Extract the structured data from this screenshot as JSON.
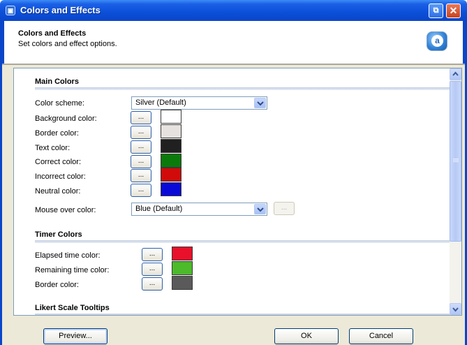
{
  "window": {
    "title": "Colors and Effects",
    "icon": "app-icon",
    "restore_glyph": "⧉",
    "close_glyph": "✕"
  },
  "header": {
    "title": "Colors and Effects",
    "subtitle": "Set colors and effect options.",
    "icon_letter": "a"
  },
  "main_colors": {
    "heading": "Main Colors",
    "color_scheme": {
      "label": "Color scheme:",
      "value": "Silver (Default)"
    },
    "rows": [
      {
        "label": "Background color:",
        "button": "...",
        "color": "#ffffff"
      },
      {
        "label": "Border color:",
        "button": "...",
        "color": "#e6e2df"
      },
      {
        "label": "Text color:",
        "button": "...",
        "color": "#202020"
      },
      {
        "label": "Correct color:",
        "button": "...",
        "color": "#0a7a0a"
      },
      {
        "label": "Incorrect color:",
        "button": "...",
        "color": "#d10a0a"
      },
      {
        "label": "Neutral color:",
        "button": "...",
        "color": "#0a0ad8"
      }
    ],
    "mouse_over": {
      "label": "Mouse over color:",
      "value": "Blue (Default)",
      "button": "..."
    }
  },
  "timer_colors": {
    "heading": "Timer Colors",
    "rows": [
      {
        "label": "Elapsed time color:",
        "button": "...",
        "color": "#e8102a"
      },
      {
        "label": "Remaining time color:",
        "button": "...",
        "color": "#4cba2a"
      },
      {
        "label": "Border color:",
        "button": "...",
        "color": "#5a5a5a"
      }
    ]
  },
  "likert": {
    "heading": "Likert Scale Tooltips"
  },
  "footer": {
    "preview": "Preview...",
    "ok": "OK",
    "cancel": "Cancel"
  }
}
